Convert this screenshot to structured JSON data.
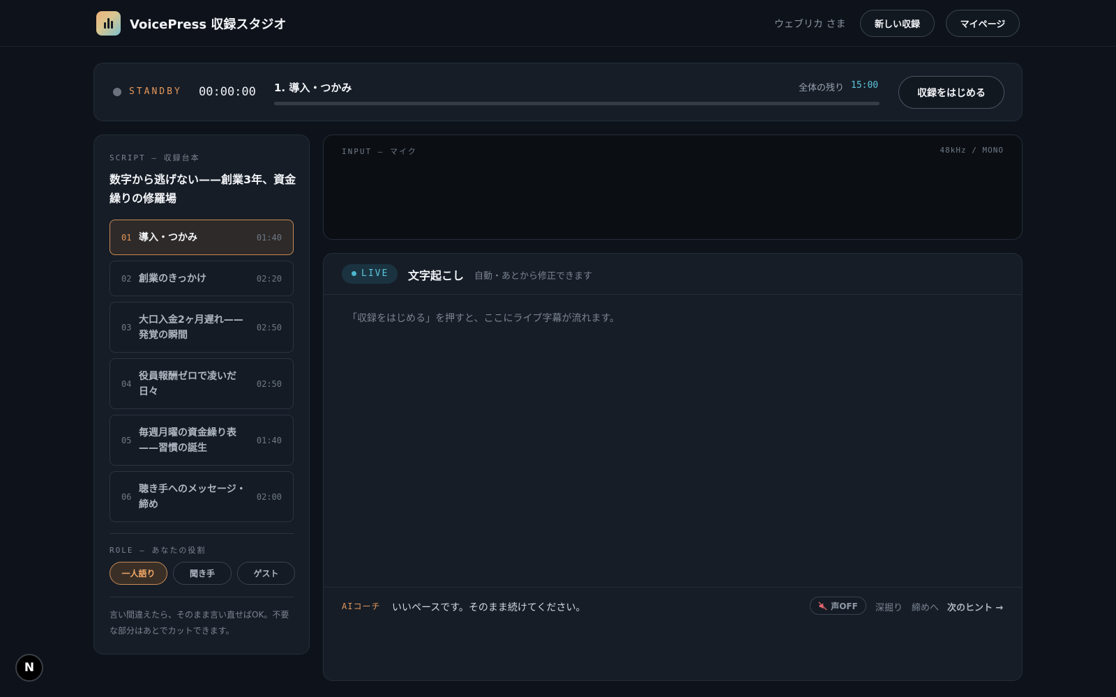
{
  "header": {
    "app_title": "VoicePress 収録スタジオ",
    "user_name": "ウェブリカ さま",
    "new_recording_label": "新しい収録",
    "mypage_label": "マイページ"
  },
  "status": {
    "state": "STANDBY",
    "timer": "00:00:00",
    "current_segment": "1. 導入・つかみ",
    "progress": 0,
    "remaining_label": "全体の残り",
    "remaining_value": "15:00",
    "record_button": "収録をはじめる"
  },
  "script": {
    "label": "SCRIPT — 収録台本",
    "title": "数字から逃げない——創業3年、資金繰りの修羅場",
    "segments": [
      {
        "num": "01",
        "name": "導入・つかみ",
        "duration": "01:40",
        "active": true
      },
      {
        "num": "02",
        "name": "創業のきっかけ",
        "duration": "02:20",
        "active": false
      },
      {
        "num": "03",
        "name": "大口入金2ヶ月遅れ——発覚の瞬間",
        "duration": "02:50",
        "active": false
      },
      {
        "num": "04",
        "name": "役員報酬ゼロで凌いだ日々",
        "duration": "02:50",
        "active": false
      },
      {
        "num": "05",
        "name": "毎週月曜の資金繰り表——習慣の誕生",
        "duration": "01:40",
        "active": false
      },
      {
        "num": "06",
        "name": "聴き手へのメッセージ・締め",
        "duration": "02:00",
        "active": false
      }
    ]
  },
  "role": {
    "label": "ROLE — あなたの役割",
    "options": [
      "一人語り",
      "聞き手",
      "ゲスト"
    ],
    "selected": "一人語り"
  },
  "hint_note": "言い間違えたら、そのまま言い直せばOK。不要な部分はあとでカットできます。",
  "input": {
    "label": "INPUT — マイク",
    "spec": "48kHz / MONO"
  },
  "transcript": {
    "live_badge": "LIVE",
    "title": "文字起こし",
    "subtitle": "自動・あとから修正できます",
    "placeholder": "「収録をはじめる」を押すと、ここにライブ字幕が流れます。"
  },
  "coach": {
    "label": "AIコーチ",
    "message": "いいペースです。そのまま続けてください。",
    "voice_toggle": "声OFF",
    "deep_dive": "深掘り",
    "wrap_up": "締めへ",
    "next_hint": "次のヒント →"
  },
  "fab": {
    "label": "N"
  },
  "colors": {
    "background": "#0e131b",
    "panel": "#161d27",
    "accent_orange": "#e4975a",
    "accent_cyan": "#5cc6dc"
  },
  "icons": {
    "logo": "bar-chart-icon",
    "voice_toggle": "speaker-muted-icon"
  }
}
